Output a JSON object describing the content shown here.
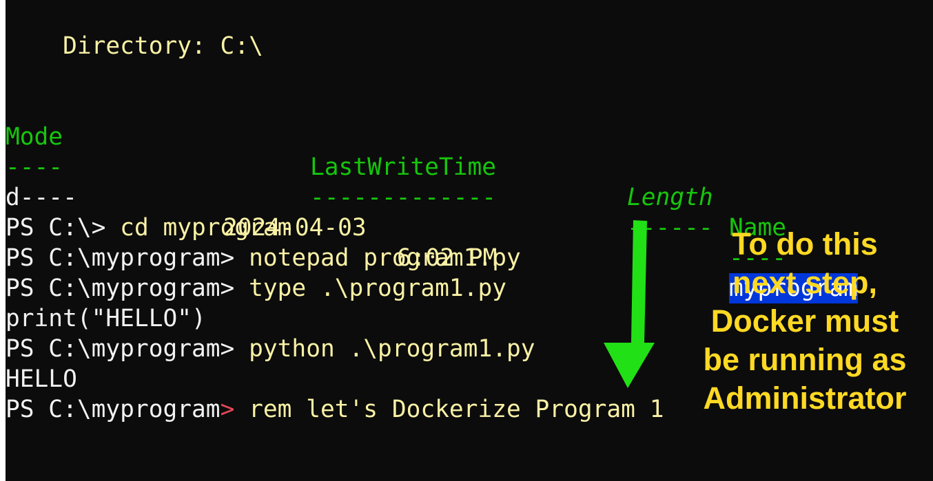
{
  "terminal": {
    "directory_line": "    Directory: C:\\",
    "headers": {
      "mode": "Mode",
      "lastwritetime": "LastWriteTime",
      "length": "Length",
      "name": "Name"
    },
    "underlines": {
      "mode": "----",
      "lastwritetime": "-------------",
      "length": "------",
      "name": "----"
    },
    "row": {
      "mode": "d----",
      "date": "2024-04-03",
      "time": "6:02 PM",
      "name": "myprogram"
    },
    "lines": [
      {
        "prompt": "PS C:\\>",
        "command": " cd myprogram"
      },
      {
        "prompt": "PS C:\\myprogram>",
        "command": " notepad program1.py"
      },
      {
        "prompt": "PS C:\\myprogram>",
        "command": " type .\\program1.py"
      },
      {
        "output": "print(\"HELLO\")"
      },
      {
        "prompt": "PS C:\\myprogram>",
        "command": " python .\\program1.py"
      },
      {
        "output": "HELLO"
      },
      {
        "prompt": "PS C:\\myprogram",
        "prompt_end": ">",
        "command": " rem let's Dockerize Program 1"
      }
    ]
  },
  "annotation": {
    "lines": [
      "To do this",
      "next step,",
      "Docker must",
      "be running as",
      "Administrator"
    ],
    "text_color": "#ffd923",
    "arrow_color": "#22e016",
    "arrow_icon": "arrow-down-icon"
  },
  "colors": {
    "background": "#0c0c0c",
    "header_green": "#16c60c",
    "text_yellow": "#f9f1a5",
    "text_white": "#f2f2f2",
    "prompt_red": "#e74856",
    "selection_blue": "#0037da"
  }
}
